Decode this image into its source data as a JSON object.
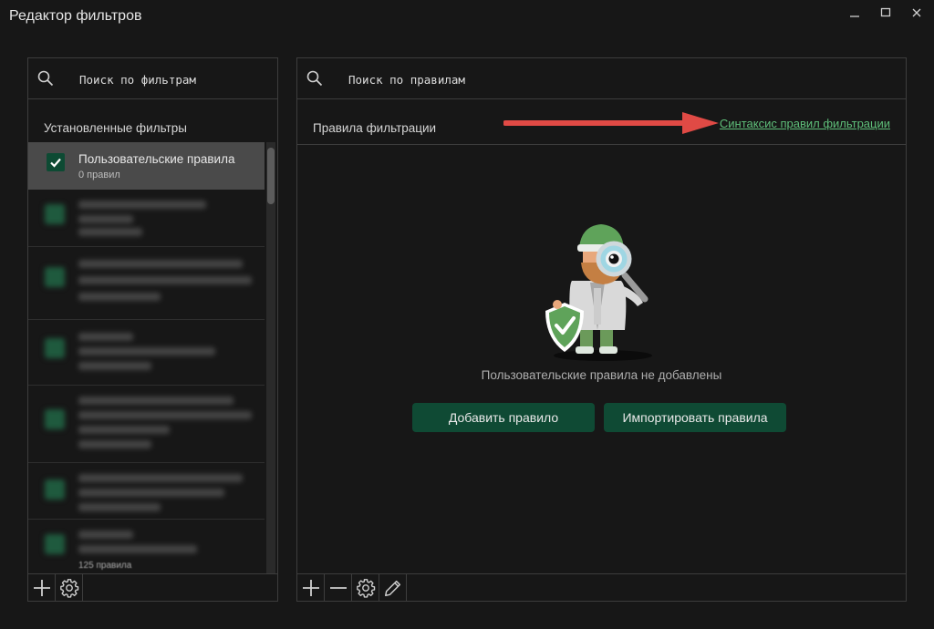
{
  "window": {
    "title": "Редактор фильтров"
  },
  "left_panel": {
    "search_placeholder": "Поиск по фильтрам",
    "section_title": "Установленные фильтры",
    "selected_item": {
      "name": "Пользовательские правила",
      "count": "0 правил",
      "checked": true
    },
    "partial_text": "125 правила"
  },
  "right_panel": {
    "search_placeholder": "Поиск по правилам",
    "section_title": "Правила фильтрации",
    "syntax_link": "Синтаксис правил фильтрации",
    "empty_message": "Пользовательские правила не добавлены",
    "add_button": "Добавить правило",
    "import_button": "Импортировать правила"
  },
  "colors": {
    "accent": "#0f4a34",
    "link": "#5fbf7a",
    "annotation_arrow": "#e04a45"
  }
}
